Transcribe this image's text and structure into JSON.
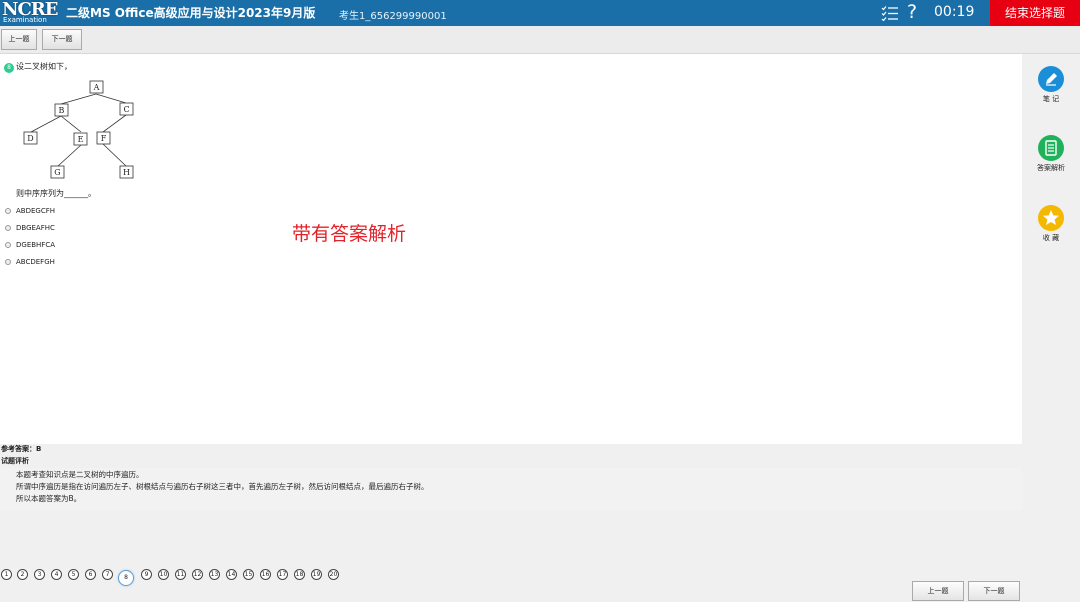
{
  "header": {
    "logo_text": "NCRE",
    "logo_sub": "Examination",
    "title": "二级MS Office高级应用与设计2023年9月版",
    "candidate": "考生1_656299990001",
    "help_symbol": "?",
    "timer": "00:19",
    "end_button": "结束选择题"
  },
  "toolbar": {
    "prev": "上一题",
    "next": "下一题"
  },
  "question": {
    "number": "8",
    "intro": "设二叉树如下，",
    "tree_nodes": {
      "a": "A",
      "b": "B",
      "c": "C",
      "d": "D",
      "e": "E",
      "f": "F",
      "g": "G",
      "h": "H"
    },
    "after": "则中序序列为______。",
    "options": [
      "ABDEGCFH",
      "DBGEAFHC",
      "DGEBHFCA",
      "ABCDEFGH"
    ]
  },
  "overlay_text": "带有答案解析",
  "side_tools": [
    {
      "label": "笔 记",
      "icon": "pencil-icon",
      "color": "#1a8fd8"
    },
    {
      "label": "答案解析",
      "icon": "document-icon",
      "color": "#1fb25a"
    },
    {
      "label": "收 藏",
      "icon": "star-icon",
      "color": "#f5b800"
    }
  ],
  "answer": {
    "reference": "参考答案：B",
    "analysis_title": "试题评析",
    "lines": [
      "本题考查知识点是二叉树的中序遍历。",
      "所谓中序遍历是指在访问遍历左子、树根结点与遍历右子树这三者中，首先遍历左子树，然后访问根结点，最后遍历右子树。",
      "所以本题答案为B。"
    ]
  },
  "pager": {
    "numbers": [
      "1",
      "2",
      "3",
      "4",
      "5",
      "6",
      "7",
      "8",
      "9",
      "10",
      "11",
      "12",
      "13",
      "14",
      "15",
      "16",
      "17",
      "18",
      "19",
      "20"
    ],
    "current": "8",
    "prev": "上一题",
    "next": "下一题"
  }
}
